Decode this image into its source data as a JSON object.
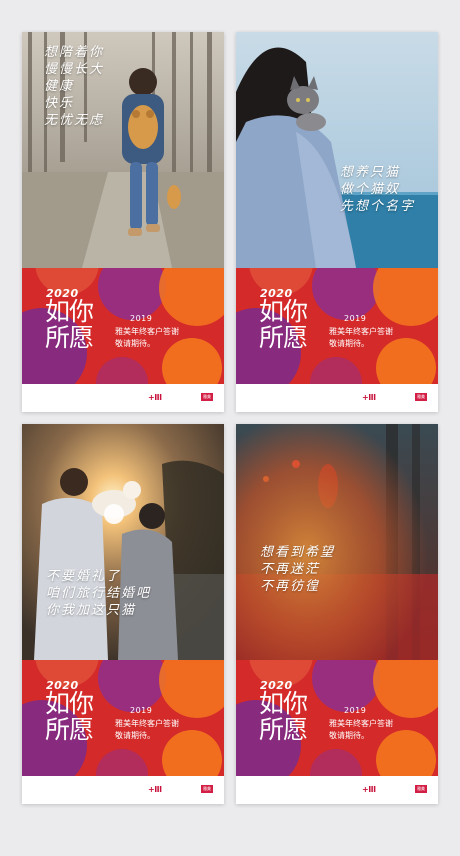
{
  "banner": {
    "year": "2020",
    "slogan": "如你所愿",
    "subyear": "2019",
    "line1": "雅美年终客户答谢",
    "line2": "敬请期待。"
  },
  "footer": {
    "mark": "+III",
    "tag": "雅美"
  },
  "cards": [
    {
      "caption": [
        "想陪着你",
        "慢慢长大",
        "健康",
        "快乐",
        "无忧无虑"
      ]
    },
    {
      "caption": [
        "想养只猫",
        "做个猫奴",
        "先想个名字"
      ]
    },
    {
      "caption": [
        "不要婚礼了",
        "咱们旅行结婚吧",
        "你我加这只猫"
      ]
    },
    {
      "caption": [
        "想看到希望",
        "不再迷茫",
        "不再彷徨"
      ]
    }
  ],
  "colors": {
    "red": "#d42a2a",
    "purple": "#7a2a8c",
    "orange": "#f4761e",
    "pink": "#d31f45"
  }
}
